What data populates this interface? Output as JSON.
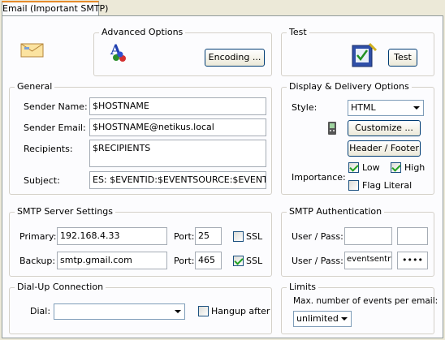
{
  "tab": {
    "label": "Email (Important SMTP)"
  },
  "advanced": {
    "title": "Advanced Options",
    "encoding_button": "Encoding ..."
  },
  "test": {
    "title": "Test",
    "button": "Test"
  },
  "general": {
    "title": "General",
    "sender_name_label": "Sender Name:",
    "sender_name_value": "$HOSTNAME",
    "sender_email_label": "Sender Email:",
    "sender_email_value": "$HOSTNAME@netikus.local",
    "recipients_label": "Recipients:",
    "recipients_value": "$RECIPIENTS",
    "subject_label": "Subject:",
    "subject_value": "ES: $EVENTID:$EVENTSOURCE:$EVENTC"
  },
  "display": {
    "title": "Display & Delivery Options",
    "style_label": "Style:",
    "style_value": "HTML",
    "customize_button": "Customize ...",
    "header_footer_button": "Header / Footer",
    "importance_label": "Importance:",
    "low_label": "Low",
    "low_checked": true,
    "high_label": "High",
    "high_checked": true,
    "flag_literal_label": "Flag Literal",
    "flag_literal_checked": false
  },
  "smtp": {
    "title": "SMTP Server Settings",
    "primary_label": "Primary:",
    "primary_value": "192.168.4.33",
    "primary_port_label": "Port:",
    "primary_port_value": "25",
    "primary_ssl_label": "SSL",
    "primary_ssl_checked": false,
    "backup_label": "Backup:",
    "backup_value": "smtp.gmail.com",
    "backup_port_label": "Port:",
    "backup_port_value": "465",
    "backup_ssl_label": "SSL",
    "backup_ssl_checked": true
  },
  "auth": {
    "title": "SMTP Authentication",
    "row1_label": "User / Pass:",
    "row1_user": "",
    "row1_pass": "",
    "row2_label": "User / Pass:",
    "row2_user": "eventsentry",
    "row2_pass": "••••"
  },
  "dialup": {
    "title": "Dial-Up Connection",
    "dial_label": "Dial:",
    "dial_value": "",
    "hangup_label": "Hangup after",
    "hangup_checked": false
  },
  "limits": {
    "title": "Limits",
    "max_label": "Max. number of events per email:",
    "max_value": "unlimited"
  },
  "icons": {
    "email": "envelope-icon",
    "font": "font-icon",
    "test": "test-icon",
    "pda": "pda-icon"
  }
}
